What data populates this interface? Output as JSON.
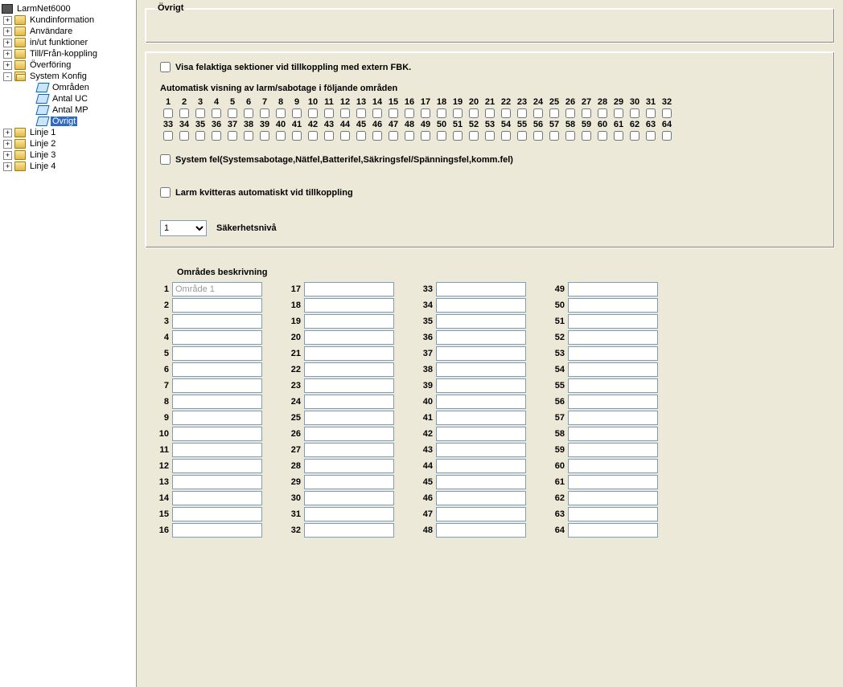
{
  "tree": {
    "root": "LarmNet6000",
    "items": [
      {
        "label": "Kundinformation",
        "type": "folder",
        "exp": "+"
      },
      {
        "label": "Användare",
        "type": "folder",
        "exp": "+"
      },
      {
        "label": "in/ut funktioner",
        "type": "folder",
        "exp": "+"
      },
      {
        "label": "Till/Från-koppling",
        "type": "folder",
        "exp": "+"
      },
      {
        "label": "Överföring",
        "type": "folder",
        "exp": "+"
      },
      {
        "label": "System Konfig",
        "type": "folder",
        "exp": "-",
        "open": true,
        "children": [
          {
            "label": "Områden",
            "type": "leaf"
          },
          {
            "label": "Antal UC",
            "type": "leaf"
          },
          {
            "label": "Antal MP",
            "type": "leaf"
          },
          {
            "label": "Övrigt",
            "type": "leaf",
            "selected": true
          }
        ]
      },
      {
        "label": "Linje 1",
        "type": "folder",
        "exp": "+"
      },
      {
        "label": "Linje 2",
        "type": "folder",
        "exp": "+"
      },
      {
        "label": "Linje 3",
        "type": "folder",
        "exp": "+"
      },
      {
        "label": "Linje 4",
        "type": "folder",
        "exp": "+"
      }
    ]
  },
  "panel_title": "Övrigt",
  "chk1_label": "Visa felaktiga sektioner vid tillkoppling med extern FBK.",
  "grid_label": "Automatisk visning av larm/sabotage i följande områden",
  "chk2_label": "System fel(Systemsabotage,Nätfel,Batterifel,Säkringsfel/Spänningsfel,komm.fel)",
  "chk3_label": "Larm kvitteras automatiskt vid tillkoppling",
  "level_label": "Säkerhetsnivå",
  "level_value": "1",
  "desc_title": "Områdes beskrivning",
  "desc": {
    "1": "Område 1",
    "2": "",
    "3": "",
    "4": "",
    "5": "",
    "6": "",
    "7": "",
    "8": "",
    "9": "",
    "10": "",
    "11": "",
    "12": "",
    "13": "",
    "14": "",
    "15": "",
    "16": "",
    "17": "",
    "18": "",
    "19": "",
    "20": "",
    "21": "",
    "22": "",
    "23": "",
    "24": "",
    "25": "",
    "26": "",
    "27": "",
    "28": "",
    "29": "",
    "30": "",
    "31": "",
    "32": "",
    "33": "",
    "34": "",
    "35": "",
    "36": "",
    "37": "",
    "38": "",
    "39": "",
    "40": "",
    "41": "",
    "42": "",
    "43": "",
    "44": "",
    "45": "",
    "46": "",
    "47": "",
    "48": "",
    "49": "",
    "50": "",
    "51": "",
    "52": "",
    "53": "",
    "54": "",
    "55": "",
    "56": "",
    "57": "",
    "58": "",
    "59": "",
    "60": "",
    "61": "",
    "62": "",
    "63": "",
    "64": ""
  }
}
